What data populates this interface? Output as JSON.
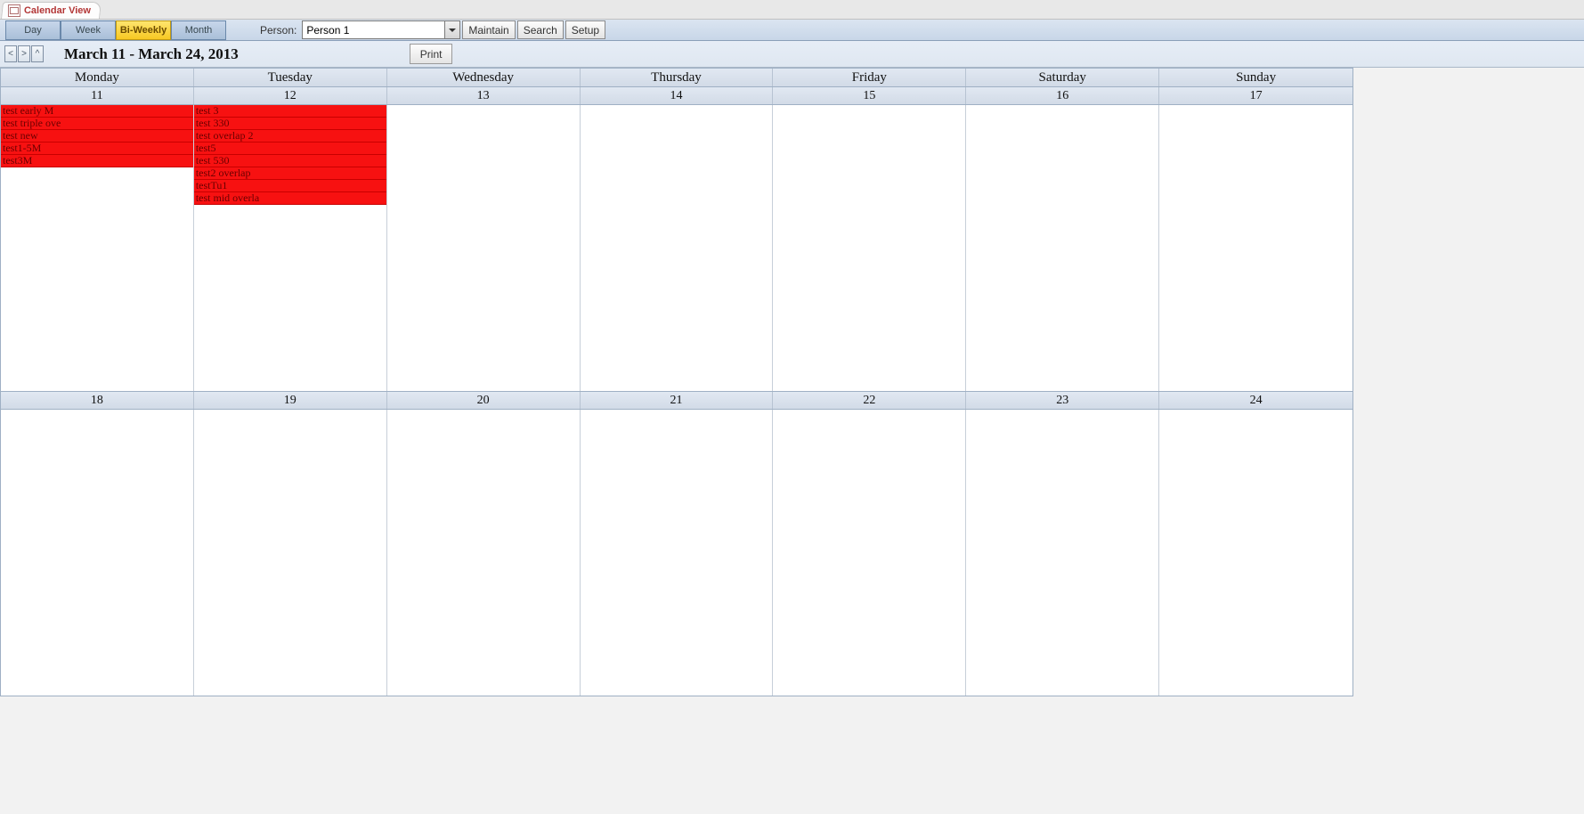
{
  "tab": {
    "title": "Calendar View"
  },
  "views": {
    "day": "Day",
    "week": "Week",
    "biweekly": "Bi-Weekly",
    "month": "Month",
    "active": "biweekly"
  },
  "person": {
    "label": "Person:",
    "selected": "Person 1"
  },
  "buttons": {
    "maintain": "Maintain",
    "search": "Search",
    "setup": "Setup",
    "print": "Print"
  },
  "nav": {
    "prev": "<",
    "next": ">",
    "up": "^"
  },
  "range_title": "March 11 - March 24, 2013",
  "day_names": [
    "Monday",
    "Tuesday",
    "Wednesday",
    "Thursday",
    "Friday",
    "Saturday",
    "Sunday"
  ],
  "weeks": [
    {
      "dates": [
        "11",
        "12",
        "13",
        "14",
        "15",
        "16",
        "17"
      ],
      "events": [
        [
          "test early M",
          "test triple ove",
          "test new",
          "test1-5M",
          "test3M"
        ],
        [
          "test 3",
          "test 330",
          "test overlap 2",
          "test5",
          "test 530",
          "test2 overlap",
          "testTu1",
          "test mid overla"
        ],
        [],
        [],
        [],
        [],
        []
      ]
    },
    {
      "dates": [
        "18",
        "19",
        "20",
        "21",
        "22",
        "23",
        "24"
      ],
      "events": [
        [],
        [],
        [],
        [],
        [],
        [],
        []
      ]
    }
  ]
}
